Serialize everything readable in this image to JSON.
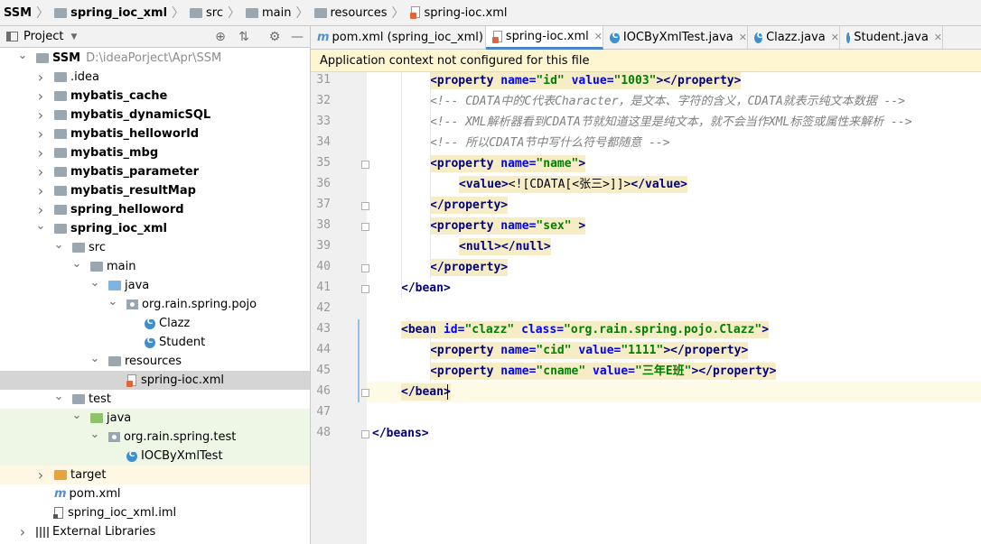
{
  "breadcrumb": [
    {
      "label": "SSM",
      "bold": true,
      "icon": "none"
    },
    {
      "label": "spring_ioc_xml",
      "bold": true,
      "icon": "module-folder-icon"
    },
    {
      "label": "src",
      "bold": false,
      "icon": "folder-icon"
    },
    {
      "label": "main",
      "bold": false,
      "icon": "folder-icon"
    },
    {
      "label": "resources",
      "bold": false,
      "icon": "resources-folder-icon"
    },
    {
      "label": "spring-ioc.xml",
      "bold": false,
      "icon": "xml-file-icon"
    }
  ],
  "project_panel": {
    "title": "Project",
    "tree": [
      {
        "label": "SSM",
        "path": "D:\\ideaPorject\\Apr\\SSM",
        "bold": true,
        "indent": 0,
        "arrow": "down",
        "icon": "folder"
      },
      {
        "label": ".idea",
        "bold": false,
        "indent": 1,
        "arrow": "right",
        "icon": "folder"
      },
      {
        "label": "mybatis_cache",
        "bold": true,
        "indent": 1,
        "arrow": "right",
        "icon": "folder"
      },
      {
        "label": "mybatis_dynamicSQL",
        "bold": true,
        "indent": 1,
        "arrow": "right",
        "icon": "folder"
      },
      {
        "label": "mybatis_helloworld",
        "bold": true,
        "indent": 1,
        "arrow": "right",
        "icon": "folder"
      },
      {
        "label": "mybatis_mbg",
        "bold": true,
        "indent": 1,
        "arrow": "right",
        "icon": "folder"
      },
      {
        "label": "mybatis_parameter",
        "bold": true,
        "indent": 1,
        "arrow": "right",
        "icon": "folder"
      },
      {
        "label": "mybatis_resultMap",
        "bold": true,
        "indent": 1,
        "arrow": "right",
        "icon": "folder"
      },
      {
        "label": "spring_helloword",
        "bold": true,
        "indent": 1,
        "arrow": "right",
        "icon": "folder"
      },
      {
        "label": "spring_ioc_xml",
        "bold": true,
        "indent": 1,
        "arrow": "down",
        "icon": "folder"
      },
      {
        "label": "src",
        "bold": false,
        "indent": 2,
        "arrow": "down",
        "icon": "folder"
      },
      {
        "label": "main",
        "bold": false,
        "indent": 3,
        "arrow": "down",
        "icon": "folder"
      },
      {
        "label": "java",
        "bold": false,
        "indent": 4,
        "arrow": "down",
        "icon": "source"
      },
      {
        "label": "org.rain.spring.pojo",
        "bold": false,
        "indent": 5,
        "arrow": "down",
        "icon": "package"
      },
      {
        "label": "Clazz",
        "bold": false,
        "indent": 6,
        "arrow": "none",
        "icon": "class"
      },
      {
        "label": "Student",
        "bold": false,
        "indent": 6,
        "arrow": "none",
        "icon": "class"
      },
      {
        "label": "resources",
        "bold": false,
        "indent": 4,
        "arrow": "down",
        "icon": "resources"
      },
      {
        "label": "spring-ioc.xml",
        "bold": false,
        "indent": 5,
        "arrow": "none",
        "icon": "xml",
        "selected": true
      },
      {
        "label": "test",
        "bold": false,
        "indent": 2,
        "arrow": "down",
        "icon": "folder"
      },
      {
        "label": "java",
        "bold": false,
        "indent": 3,
        "arrow": "down",
        "icon": "test-source",
        "test": true
      },
      {
        "label": "org.rain.spring.test",
        "bold": false,
        "indent": 4,
        "arrow": "down",
        "icon": "package",
        "test": true
      },
      {
        "label": "IOCByXmlTest",
        "bold": false,
        "indent": 5,
        "arrow": "none",
        "icon": "class",
        "test": true
      },
      {
        "label": "target",
        "bold": false,
        "indent": 1,
        "arrow": "right",
        "icon": "excluded",
        "target": true
      },
      {
        "label": "pom.xml",
        "bold": false,
        "indent": 1,
        "arrow": "none",
        "icon": "maven"
      },
      {
        "label": "spring_ioc_xml.iml",
        "bold": false,
        "indent": 1,
        "arrow": "none",
        "icon": "iml"
      },
      {
        "label": "External Libraries",
        "bold": false,
        "indent": 0,
        "arrow": "right",
        "icon": "library"
      }
    ]
  },
  "tabs": [
    {
      "label": "pom.xml (spring_ioc_xml)",
      "icon": "maven-icon",
      "active": false
    },
    {
      "label": "spring-ioc.xml",
      "icon": "xml-file-icon",
      "active": true
    },
    {
      "label": "IOCByXmlTest.java",
      "icon": "class-icon",
      "active": false
    },
    {
      "label": "Clazz.java",
      "icon": "class-icon",
      "active": false
    },
    {
      "label": "Student.java",
      "icon": "class-icon",
      "active": false
    }
  ],
  "notice": "Application context not configured for this file",
  "editor": {
    "current_line": 46,
    "lines": [
      {
        "n": 31,
        "indent": 2,
        "tokens": [
          [
            "tag",
            "<property "
          ],
          [
            "attr",
            "name="
          ],
          [
            "val",
            "\"id\""
          ],
          [
            "txt",
            " "
          ],
          [
            "attr",
            "value="
          ],
          [
            "val",
            "\"1003\""
          ],
          [
            "tag",
            "></property>"
          ]
        ],
        "hl": true
      },
      {
        "n": 32,
        "indent": 2,
        "tokens": [
          [
            "cmt",
            "<!-- CDATA中的C代表Character，是文本、字符的含义，CDATA就表示纯文本数据 -->"
          ]
        ]
      },
      {
        "n": 33,
        "indent": 2,
        "tokens": [
          [
            "cmt",
            "<!-- XML解析器看到CDATA节就知道这里是纯文本，就不会当作XML标签或属性来解析 -->"
          ]
        ]
      },
      {
        "n": 34,
        "indent": 2,
        "tokens": [
          [
            "cmt",
            "<!-- 所以CDATA节中写什么符号都随意 -->"
          ]
        ]
      },
      {
        "n": 35,
        "indent": 2,
        "tokens": [
          [
            "tag",
            "<property "
          ],
          [
            "attr",
            "name="
          ],
          [
            "val",
            "\"name\""
          ],
          [
            "tag",
            ">"
          ]
        ],
        "hl": true
      },
      {
        "n": 36,
        "indent": 3,
        "tokens": [
          [
            "tag",
            "<value>"
          ],
          [
            "txt",
            "<![CDATA[<张三>]]>"
          ],
          [
            "tag",
            "</value>"
          ]
        ],
        "hl": true
      },
      {
        "n": 37,
        "indent": 2,
        "tokens": [
          [
            "tag",
            "</property>"
          ]
        ],
        "hl": true
      },
      {
        "n": 38,
        "indent": 2,
        "tokens": [
          [
            "tag",
            "<property "
          ],
          [
            "attr",
            "name="
          ],
          [
            "val",
            "\"sex\""
          ],
          [
            "txt",
            " "
          ],
          [
            "tag",
            ">"
          ]
        ],
        "hl": true
      },
      {
        "n": 39,
        "indent": 3,
        "tokens": [
          [
            "tag",
            "<null></null>"
          ]
        ],
        "hl": true
      },
      {
        "n": 40,
        "indent": 2,
        "tokens": [
          [
            "tag",
            "</property>"
          ]
        ],
        "hl": true
      },
      {
        "n": 41,
        "indent": 1,
        "tokens": [
          [
            "tag",
            "</bean>"
          ]
        ]
      },
      {
        "n": 42,
        "indent": 0,
        "tokens": []
      },
      {
        "n": 43,
        "indent": 1,
        "tokens": [
          [
            "tag",
            "<bean "
          ],
          [
            "attr",
            "id="
          ],
          [
            "val",
            "\"clazz\""
          ],
          [
            "txt",
            " "
          ],
          [
            "attr",
            "class="
          ],
          [
            "val",
            "\"org.rain.spring.pojo.Clazz\""
          ],
          [
            "tag",
            ">"
          ]
        ],
        "hl": true
      },
      {
        "n": 44,
        "indent": 2,
        "tokens": [
          [
            "tag",
            "<property "
          ],
          [
            "attr",
            "name="
          ],
          [
            "val",
            "\"cid\""
          ],
          [
            "txt",
            " "
          ],
          [
            "attr",
            "value="
          ],
          [
            "val",
            "\"1111\""
          ],
          [
            "tag",
            "></property>"
          ]
        ],
        "hl": true
      },
      {
        "n": 45,
        "indent": 2,
        "tokens": [
          [
            "tag",
            "<property "
          ],
          [
            "attr",
            "name="
          ],
          [
            "val",
            "\"cname\""
          ],
          [
            "txt",
            " "
          ],
          [
            "attr",
            "value="
          ],
          [
            "val",
            "\"三年E班\""
          ],
          [
            "tag",
            "></property>"
          ]
        ],
        "hl": true
      },
      {
        "n": 46,
        "indent": 1,
        "tokens": [
          [
            "tag",
            "</bean>"
          ]
        ],
        "hl": true
      },
      {
        "n": 47,
        "indent": 0,
        "tokens": []
      },
      {
        "n": 48,
        "indent": 0,
        "tokens": [
          [
            "tag",
            "</beans>"
          ]
        ]
      }
    ],
    "folds": [
      35,
      37,
      38,
      40,
      41,
      46,
      48
    ]
  }
}
